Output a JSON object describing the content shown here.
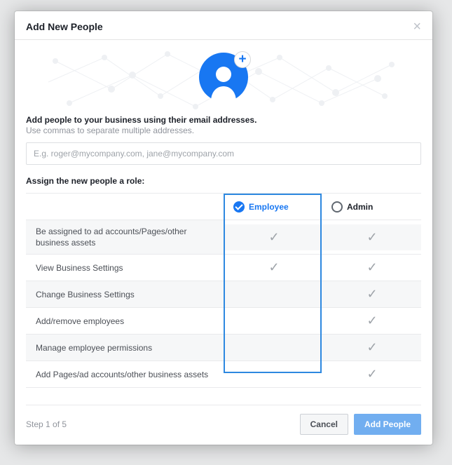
{
  "modal": {
    "title": "Add New People",
    "instructions": {
      "main": "Add people to your business using their email addresses.",
      "sub": "Use commas to separate multiple addresses."
    },
    "email_placeholder": "E.g. roger@mycompany.com, jane@mycompany.com",
    "assign_label": "Assign the new people a role:",
    "roles": {
      "employee": "Employee",
      "admin": "Admin",
      "selected": "employee"
    },
    "permissions": [
      {
        "label": "Be assigned to ad accounts/Pages/other business assets",
        "employee": true,
        "admin": true
      },
      {
        "label": "View Business Settings",
        "employee": true,
        "admin": true
      },
      {
        "label": "Change Business Settings",
        "employee": false,
        "admin": true
      },
      {
        "label": "Add/remove employees",
        "employee": false,
        "admin": true
      },
      {
        "label": "Manage employee permissions",
        "employee": false,
        "admin": true
      },
      {
        "label": "Add Pages/ad accounts/other business assets",
        "employee": false,
        "admin": true
      }
    ],
    "step": "Step 1 of 5",
    "buttons": {
      "cancel": "Cancel",
      "submit": "Add People"
    }
  }
}
